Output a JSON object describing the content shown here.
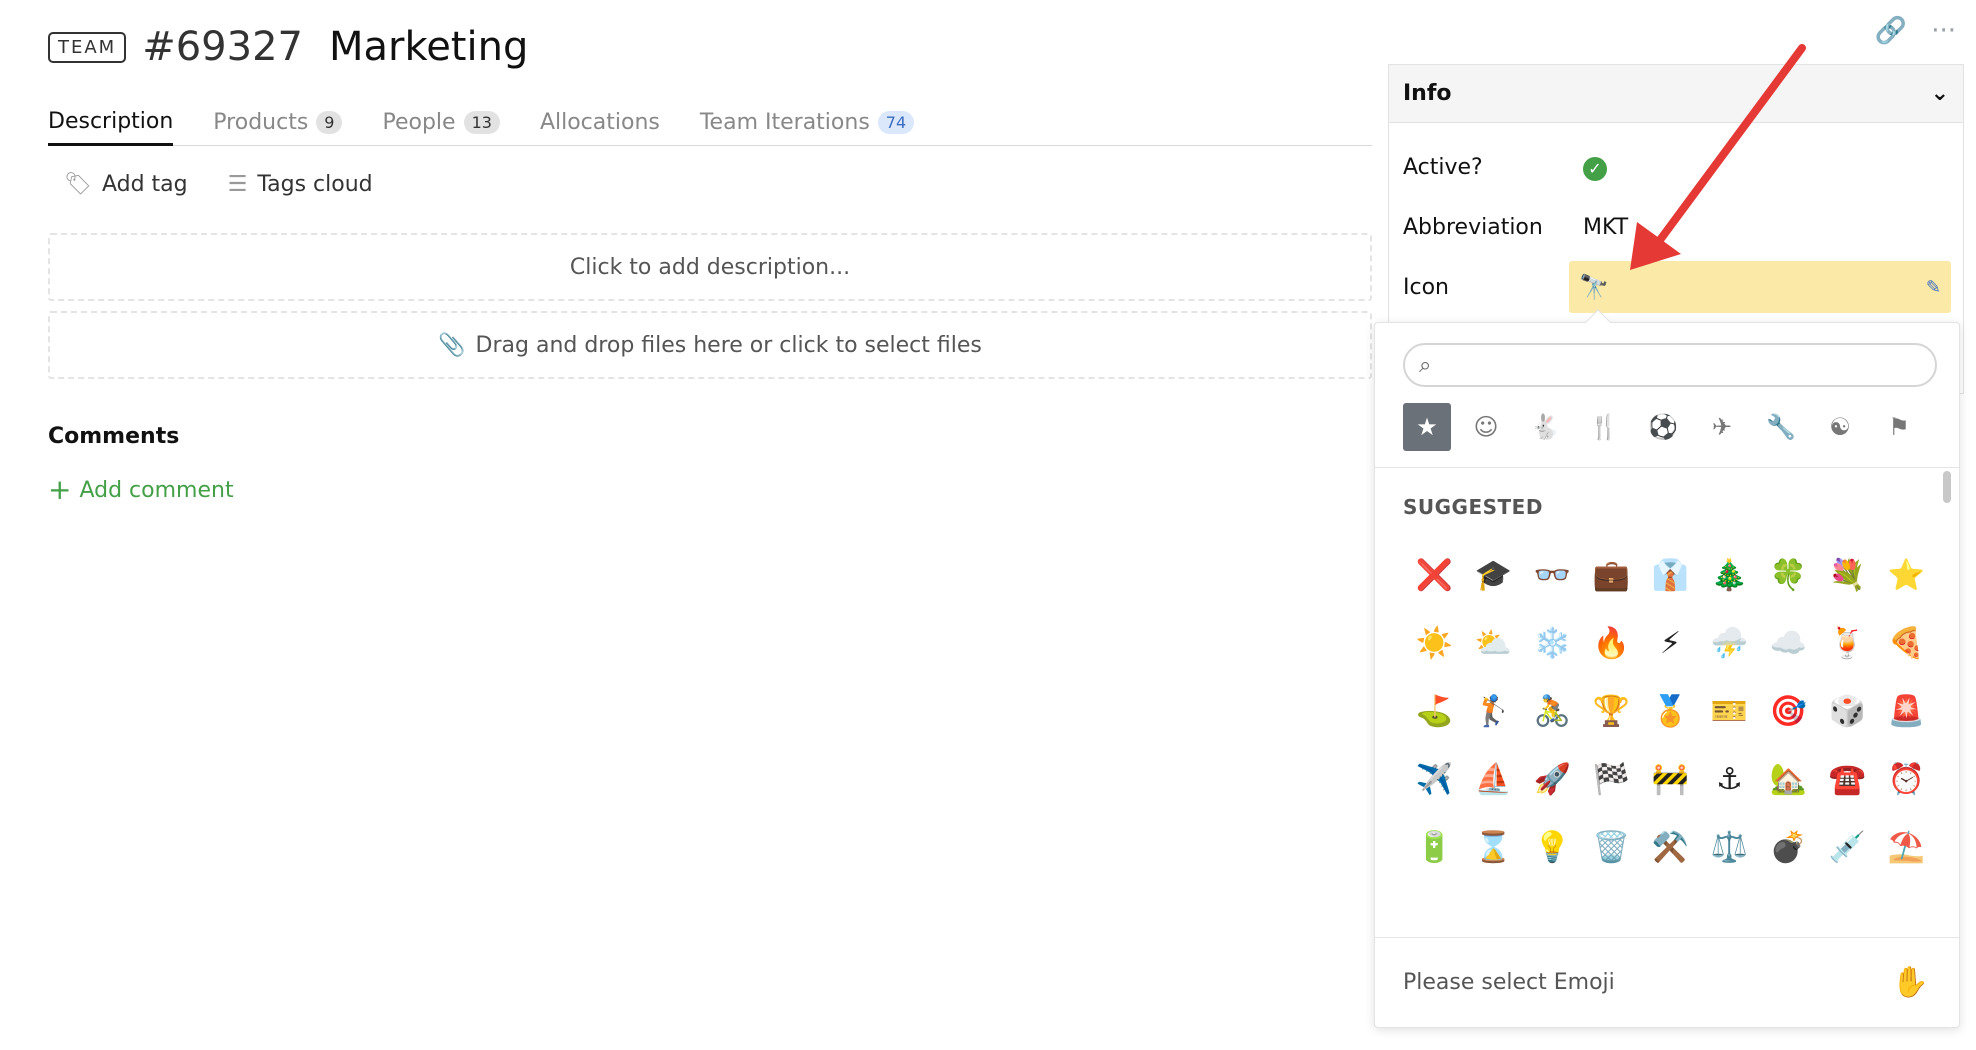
{
  "header": {
    "badge": "TEAM",
    "id": "#69327",
    "name": "Marketing",
    "link_icon": "link-icon",
    "more_icon": "more-icon"
  },
  "tabs": [
    {
      "label": "Description",
      "count": ""
    },
    {
      "label": "Products",
      "count": "9"
    },
    {
      "label": "People",
      "count": "13"
    },
    {
      "label": "Allocations",
      "count": ""
    },
    {
      "label": "Team Iterations",
      "count": "74"
    }
  ],
  "tagbar": {
    "add_tag": "Add tag",
    "tags_cloud": "Tags cloud"
  },
  "description": {
    "placeholder": "Click to add description...",
    "files": "Drag and drop files here or click to select files"
  },
  "comments": {
    "title": "Comments",
    "add": "Add comment"
  },
  "info": {
    "title": "Info",
    "active_label": "Active?",
    "abbrev_label": "Abbreviation",
    "abbrev_value": "MKT",
    "icon_label": "Icon",
    "icon_value": "🔭"
  },
  "picker": {
    "categories": [
      "star-icon",
      "smiley-icon",
      "animal-icon",
      "food-icon",
      "ball-icon",
      "plane-icon",
      "wrench-icon",
      "symbols-icon",
      "flag-icon"
    ],
    "section": "SUGGESTED",
    "emojis": [
      "❌",
      "🎓",
      "👓",
      "💼",
      "👔",
      "🎄",
      "🍀",
      "💐",
      "⭐",
      "☀️",
      "⛅",
      "❄️",
      "🔥",
      "⚡",
      "⛈️",
      "☁️",
      "🍹",
      "🍕",
      "⛳",
      "🏌️",
      "🚴",
      "🏆",
      "🏅",
      "🎫",
      "🎯",
      "🎲",
      "🚨",
      "✈️",
      "⛵",
      "🚀",
      "🏁",
      "🚧",
      "⚓",
      "🏡",
      "☎️",
      "⏰",
      "🔋",
      "⌛",
      "💡",
      "🗑️",
      "⚒️",
      "⚖️",
      "💣",
      "💉",
      "⛱️",
      "📥",
      "✉️",
      "🎉",
      "📅",
      "📒",
      "📔",
      "📙",
      "📘",
      "📗"
    ],
    "footer": "Please select Emoji",
    "footer_icon": "✋"
  },
  "colors": {
    "accent_green": "#43a047",
    "icon_highlight": "#fbe9a7",
    "arrow": "#e53935"
  }
}
